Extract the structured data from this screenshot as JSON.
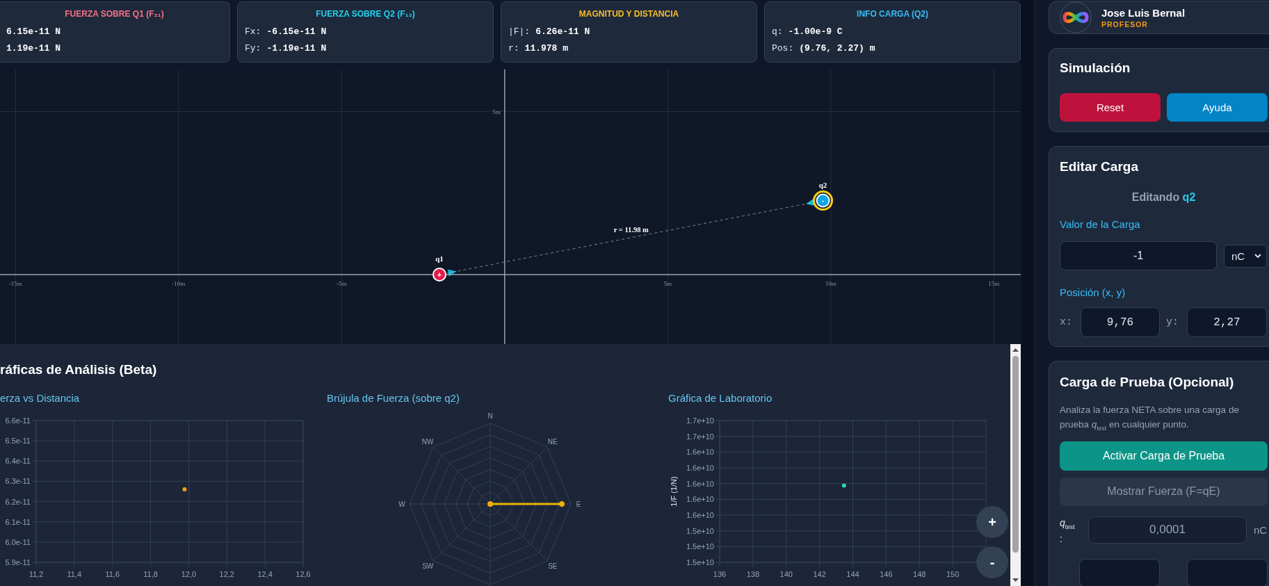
{
  "info_cards": [
    {
      "title": "FUERZA SOBRE Q1 (F₂₁)",
      "color": "#fb7185",
      "rows": [
        {
          "value": "6.15e-11 N"
        },
        {
          "value": "1.19e-11 N"
        }
      ]
    },
    {
      "title": "FUERZA SOBRE Q2 (F₁₂)",
      "color": "#22d3ee",
      "rows": [
        {
          "label": "Fx:",
          "value": "-6.15e-11 N"
        },
        {
          "label": "Fy:",
          "value": "-1.19e-11 N"
        }
      ]
    },
    {
      "title": "MAGNITUD Y DISTANCIA",
      "color": "#fbbf24",
      "rows": [
        {
          "label": "|F|:",
          "value": "6.26e-11 N"
        },
        {
          "label": "r:",
          "value": "11.978 m"
        }
      ]
    },
    {
      "title": "INFO CARGA (Q2)",
      "color": "#38bdf8",
      "rows": [
        {
          "label": "q:",
          "value": "-1.00e-9 C"
        },
        {
          "label": "Pos:",
          "value": "(9.76, 2.27) m"
        }
      ]
    }
  ],
  "canvas": {
    "x_ticks": [
      "-15m",
      "-10m",
      "-5m",
      "5m",
      "10m",
      "15m"
    ],
    "y_ticks": [
      "5m"
    ],
    "distance_label": "r = 11.98 m",
    "charges": [
      {
        "name": "q1",
        "symbol": "+",
        "kind": "positive",
        "selected": false
      },
      {
        "name": "q2",
        "symbol": "-",
        "kind": "negative",
        "selected": true
      }
    ]
  },
  "analysis": {
    "heading": "ráficas de Análisis (Beta)",
    "force_distance": {
      "chart_data": {
        "type": "scatter",
        "title": "erza vs Distancia",
        "grid": true,
        "x": [
          11.978
        ],
        "series": [
          {
            "color": "#f59e0b",
            "values": [
              6.26e-11
            ]
          }
        ],
        "xlim": [
          11.2,
          12.6
        ],
        "ylim": [
          5.9e-11,
          6.6e-11
        ],
        "xticks": [
          {
            "value": 11.2,
            "label": "11,2"
          },
          {
            "value": 11.4,
            "label": "11,4"
          },
          {
            "value": 11.6,
            "label": "11,6"
          },
          {
            "value": 11.8,
            "label": "11,8"
          },
          {
            "value": 12,
            "label": "12,0"
          },
          {
            "value": 12.2,
            "label": "12,2"
          },
          {
            "value": 12.4,
            "label": "12,4"
          },
          {
            "value": 12.6,
            "label": "12,6"
          }
        ],
        "yticks": [
          {
            "value": 6.6e-11,
            "label": "6.6e-11"
          },
          {
            "value": 6.5e-11,
            "label": "6.5e-11"
          },
          {
            "value": 6.4e-11,
            "label": "6.4e-11"
          },
          {
            "value": 6.3e-11,
            "label": "6.3e-11"
          },
          {
            "value": 6.2e-11,
            "label": "6.2e-11"
          },
          {
            "value": 6.1e-11,
            "label": "6.1e-11"
          },
          {
            "value": 6e-11,
            "label": "6.0e-11"
          },
          {
            "value": 5.9e-11,
            "label": "5.9e-11"
          }
        ]
      }
    },
    "compass": {
      "title": "Brújula de Fuerza (sobre q2)",
      "directions": [
        "N",
        "NE",
        "E",
        "SE",
        "SW",
        "W",
        "NW"
      ]
    },
    "lab": {
      "chart_data": {
        "type": "scatter",
        "title": "Gráfica de Laboratorio",
        "grid": true,
        "ylabel": "1/F (1/N)",
        "x": [
          143.47
        ],
        "series": [
          {
            "color": "#2dd4bf",
            "values": [
              15970000000.0
            ]
          }
        ],
        "xlim": [
          136,
          152
        ],
        "ylim": [
          14750000000.0,
          17000000000.0
        ],
        "xticks": [
          136,
          138,
          140,
          142,
          144,
          146,
          148,
          150
        ],
        "yticks": [
          {
            "value": 17000000000.0,
            "label": "1.7e+10"
          },
          {
            "value": 16750000000.0,
            "label": "1.7e+10"
          },
          {
            "value": 16500000000.0,
            "label": "1.6e+10"
          },
          {
            "value": 16250000000.0,
            "label": "1.6e+10"
          },
          {
            "value": 16000000000.0,
            "label": "1.6e+10"
          },
          {
            "value": 15750000000.0,
            "label": "1.6e+10"
          },
          {
            "value": 15500000000.0,
            "label": "1.6e+10"
          },
          {
            "value": 15250000000.0,
            "label": "1.5e+10"
          },
          {
            "value": 15000000000.0,
            "label": "1.5e+10"
          },
          {
            "value": 14750000000.0,
            "label": "1.5e+10"
          }
        ]
      }
    },
    "zoom_buttons": [
      "+",
      "-"
    ]
  },
  "sidebar": {
    "profile": {
      "name": "Jose Luis Bernal",
      "role": "PROFESOR"
    },
    "simulation": {
      "title": "Simulación",
      "buttons": [
        {
          "label": "Reset",
          "kind": "reset"
        },
        {
          "label": "Ayuda",
          "kind": "help"
        }
      ]
    },
    "edit_charge": {
      "title": "Editar Carga",
      "editing": {
        "prefix": "Editando",
        "target": "q2"
      },
      "value_label": "Valor de la Carga",
      "value": "-1",
      "unit": "nC",
      "position_label": "Posición (x, y)",
      "position": [
        {
          "label": "x:",
          "value": "9,76"
        },
        {
          "label": "y:",
          "value": "2,27"
        }
      ]
    },
    "test_charge": {
      "title": "Carga de Prueba (Opcional)",
      "description": "Analiza la fuerza NETA sobre una carga de prueba *q*$_{test}$ en cualquier punto.",
      "buttons": [
        {
          "label": "Activar Carga de Prueba",
          "disabled": false
        },
        {
          "label": "Mostrar Fuerza (F=qE)",
          "disabled": true
        }
      ],
      "charge_label": "*q*$_{test}$ :",
      "charge_value": "0,0001",
      "charge_disabled": true,
      "charge_unit": "nC"
    }
  }
}
